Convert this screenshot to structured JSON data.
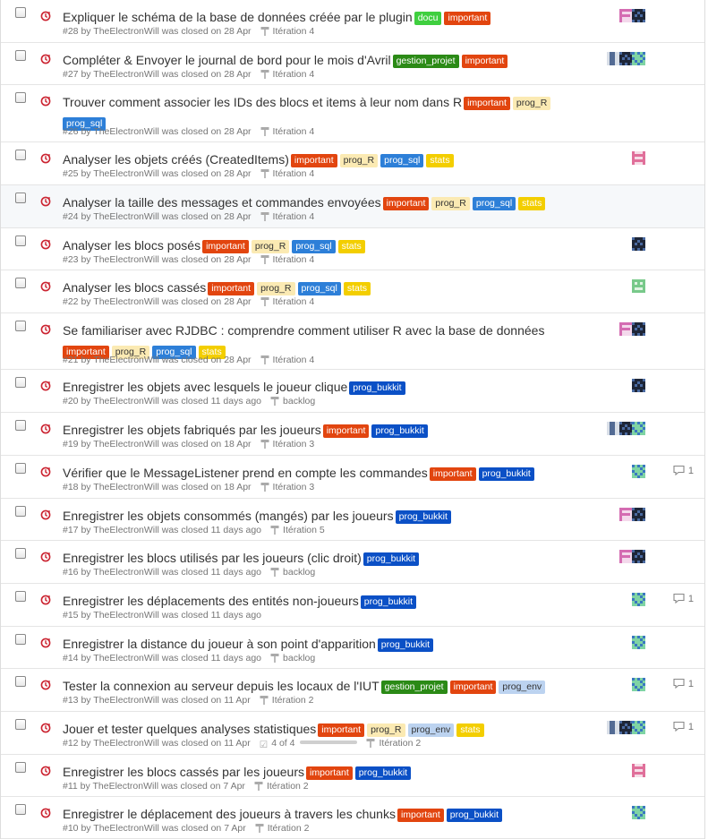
{
  "colors": {
    "important": "#e2450f",
    "docu": "#3fcf3f",
    "prog_R": "#fbeab3",
    "prog_sql": "#2d7fd8",
    "stats": "#f3ce00",
    "gestion_projet": "#2b8a16",
    "prog_bukkit": "#0b50c6",
    "prog_env": "#bcd3f0"
  },
  "issues": [
    {
      "title": "Expliquer le schéma de la base de données créée par le plugin",
      "labels": [
        "docu",
        "important"
      ],
      "number": "#28",
      "by": "by",
      "author": "TheElectronWill",
      "closed": "was closed on 28 Apr",
      "milestone": "Itération 4",
      "avatars": [
        "f",
        "b"
      ],
      "comments": ""
    },
    {
      "title": "Compléter & Envoyer le journal de bord pour le mois d'Avril",
      "labels": [
        "gestion_projet",
        "important"
      ],
      "number": "#27",
      "by": "by",
      "author": "TheElectronWill",
      "closed": "was closed on 28 Apr",
      "milestone": "Itération 4",
      "avatars": [
        "g",
        "b",
        "t"
      ],
      "comments": ""
    },
    {
      "title": "Trouver comment associer les IDs des blocs et items à leur nom dans R",
      "labels": [
        "important",
        "prog_R",
        "prog_sql"
      ],
      "number": "#26",
      "by": "by",
      "author": "TheElectronWill",
      "closed": "was closed on 28 Apr",
      "milestone": "Itération 4",
      "avatars": [],
      "comments": ""
    },
    {
      "title": "Analyser les objets créés (CreatedItems)",
      "labels": [
        "important",
        "prog_R",
        "prog_sql",
        "stats"
      ],
      "number": "#25",
      "by": "by",
      "author": "TheElectronWill",
      "closed": "was closed on 28 Apr",
      "milestone": "Itération 4",
      "avatars": [
        "p"
      ],
      "comments": ""
    },
    {
      "title": "Analyser la taille des messages et commandes envoyées",
      "labels": [
        "important",
        "prog_R",
        "prog_sql",
        "stats"
      ],
      "number": "#24",
      "by": "by",
      "author": "TheElectronWill",
      "closed": "was closed on 28 Apr",
      "milestone": "Itération 4",
      "avatars": [],
      "comments": ""
    },
    {
      "title": "Analyser les blocs posés",
      "labels": [
        "important",
        "prog_R",
        "prog_sql",
        "stats"
      ],
      "number": "#23",
      "by": "by",
      "author": "TheElectronWill",
      "closed": "was closed on 28 Apr",
      "milestone": "Itération 4",
      "avatars": [
        "b"
      ],
      "comments": ""
    },
    {
      "title": "Analyser les blocs cassés",
      "labels": [
        "important",
        "prog_R",
        "prog_sql",
        "stats"
      ],
      "number": "#22",
      "by": "by",
      "author": "TheElectronWill",
      "closed": "was closed on 28 Apr",
      "milestone": "Itération 4",
      "avatars": [
        "m"
      ],
      "comments": ""
    },
    {
      "title": "Se familiariser avec RJDBC : comprendre comment utiliser R avec la base de données",
      "labels": [
        "important",
        "prog_R",
        "prog_sql",
        "stats"
      ],
      "number": "#21",
      "by": "by",
      "author": "TheElectronWill",
      "closed": "was closed on 28 Apr",
      "milestone": "Itération 4",
      "avatars": [
        "f",
        "b"
      ],
      "comments": ""
    },
    {
      "title": "Enregistrer les objets avec lesquels le joueur clique",
      "labels": [
        "prog_bukkit"
      ],
      "number": "#20",
      "by": "by",
      "author": "TheElectronWill",
      "closed": "was closed 11 days ago",
      "milestone": "backlog",
      "avatars": [
        "b"
      ],
      "comments": ""
    },
    {
      "title": "Enregistrer les objets fabriqués par les joueurs",
      "labels": [
        "important",
        "prog_bukkit"
      ],
      "number": "#19",
      "by": "by",
      "author": "TheElectronWill",
      "closed": "was closed on 18 Apr",
      "milestone": "Itération 3",
      "avatars": [
        "g",
        "b",
        "t"
      ],
      "comments": ""
    },
    {
      "title": "Vérifier que le MessageListener prend en compte les commandes",
      "labels": [
        "important",
        "prog_bukkit"
      ],
      "number": "#18",
      "by": "by",
      "author": "TheElectronWill",
      "closed": "was closed on 18 Apr",
      "milestone": "Itération 3",
      "avatars": [
        "t"
      ],
      "comments": "1"
    },
    {
      "title": "Enregistrer les objets consommés (mangés) par les joueurs",
      "labels": [
        "prog_bukkit"
      ],
      "number": "#17",
      "by": "by",
      "author": "TheElectronWill",
      "closed": "was closed 11 days ago",
      "milestone": "Itération 5",
      "avatars": [
        "f",
        "b"
      ],
      "comments": ""
    },
    {
      "title": "Enregistrer les blocs utilisés par les joueurs (clic droit)",
      "labels": [
        "prog_bukkit"
      ],
      "number": "#16",
      "by": "by",
      "author": "TheElectronWill",
      "closed": "was closed 11 days ago",
      "milestone": "backlog",
      "avatars": [
        "f",
        "b"
      ],
      "comments": ""
    },
    {
      "title": "Enregistrer les déplacements des entités non-joueurs",
      "labels": [
        "prog_bukkit"
      ],
      "number": "#15",
      "by": "by",
      "author": "TheElectronWill",
      "closed": "was closed 11 days ago",
      "milestone": "",
      "avatars": [
        "t"
      ],
      "comments": "1"
    },
    {
      "title": "Enregistrer la distance du joueur à son point d'apparition",
      "labels": [
        "prog_bukkit"
      ],
      "number": "#14",
      "by": "by",
      "author": "TheElectronWill",
      "closed": "was closed 11 days ago",
      "milestone": "backlog",
      "avatars": [
        "t"
      ],
      "comments": ""
    },
    {
      "title": "Tester la connexion au serveur depuis les locaux de l'IUT",
      "labels": [
        "gestion_projet",
        "important",
        "prog_env"
      ],
      "number": "#13",
      "by": "by",
      "author": "TheElectronWill",
      "closed": "was closed on 11 Apr",
      "milestone": "Itération 2",
      "avatars": [
        "t"
      ],
      "comments": "1"
    },
    {
      "title": "Jouer et tester quelques analyses statistiques",
      "labels": [
        "important",
        "prog_R",
        "prog_env",
        "stats"
      ],
      "number": "#12",
      "by": "by",
      "author": "TheElectronWill",
      "closed": "was closed on 11 Apr",
      "milestone": "Itération 2",
      "progress_text": "4 of 4",
      "progress": 1.0,
      "avatars": [
        "g",
        "b",
        "t"
      ],
      "comments": "1"
    },
    {
      "title": "Enregistrer les blocs cassés par les joueurs",
      "labels": [
        "important",
        "prog_bukkit"
      ],
      "number": "#11",
      "by": "by",
      "author": "TheElectronWill",
      "closed": "was closed on 7 Apr",
      "milestone": "Itération 2",
      "avatars": [
        "p"
      ],
      "comments": ""
    },
    {
      "title": "Enregistrer le déplacement des joueurs à travers les chunks",
      "labels": [
        "important",
        "prog_bukkit"
      ],
      "number": "#10",
      "by": "by",
      "author": "TheElectronWill",
      "closed": "was closed on 7 Apr",
      "milestone": "Itération 2",
      "avatars": [
        "t"
      ],
      "comments": ""
    }
  ]
}
